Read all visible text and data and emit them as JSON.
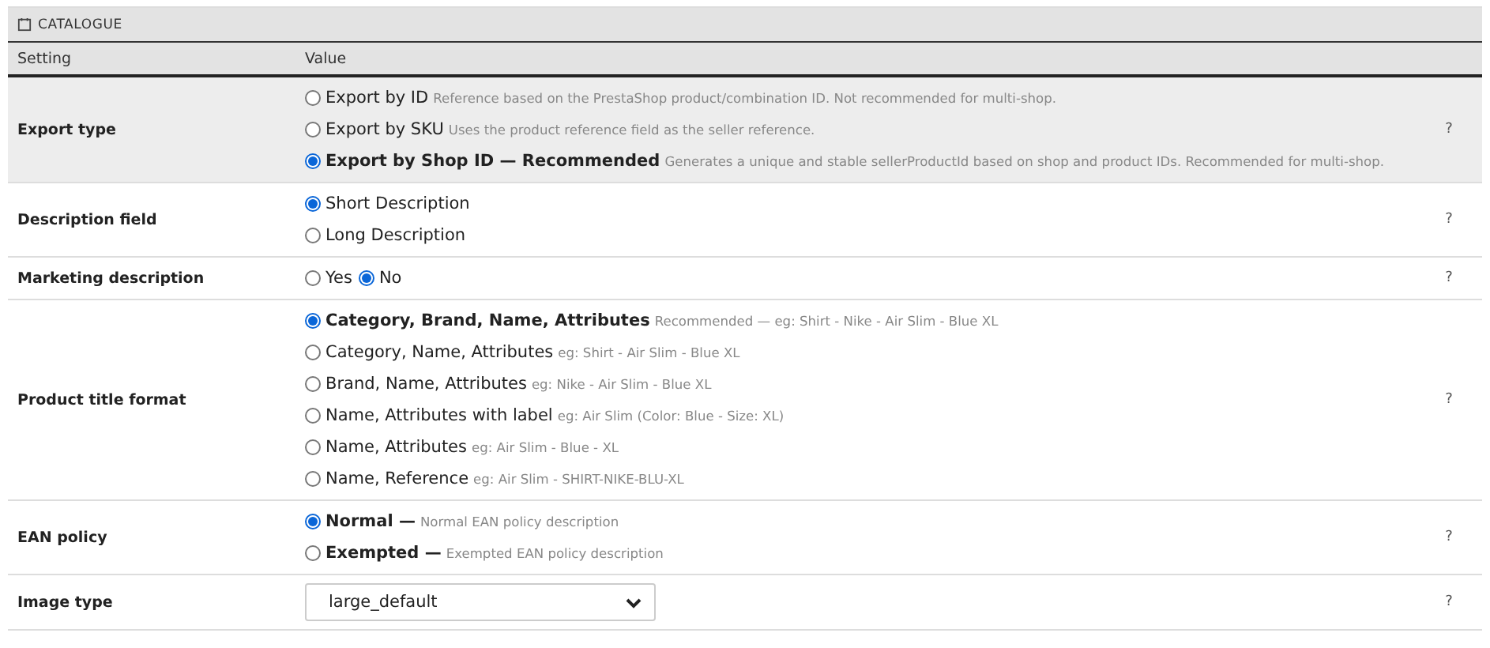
{
  "panel": {
    "title": "CATALOGUE"
  },
  "columns": [
    "Setting",
    "Value"
  ],
  "rows": [
    {
      "setting": "Export type",
      "kind": "radio",
      "highlighted": true,
      "help": "?",
      "options": [
        {
          "label": "Export by ID",
          "description": "Reference based on the PrestaShop product/combination ID. Not recommended for multi-shop.",
          "bold": false,
          "selected": false
        },
        {
          "label": "Export by SKU",
          "description": "Uses the product reference field as the seller reference.",
          "bold": false,
          "selected": false
        },
        {
          "label": "Export by Shop ID — Recommended",
          "description": "Generates a unique and stable sellerProductId based on shop and product IDs. Recommended for multi-shop.",
          "bold": true,
          "selected": true
        }
      ]
    },
    {
      "setting": "Description field",
      "kind": "radio",
      "highlighted": false,
      "help": "?",
      "options": [
        {
          "label": "Short Description",
          "bold": false,
          "selected": true
        },
        {
          "label": "Long Description",
          "bold": false,
          "selected": false
        }
      ]
    },
    {
      "setting": "Marketing description",
      "kind": "radio_inline",
      "highlighted": false,
      "help": "?",
      "options": [
        {
          "label": "Yes",
          "bold": false,
          "selected": false
        },
        {
          "label": "No",
          "bold": false,
          "selected": true
        }
      ]
    },
    {
      "setting": "Product title format",
      "kind": "radio",
      "highlighted": false,
      "help": "?",
      "options": [
        {
          "label": "Category, Brand, Name, Attributes",
          "description": "Recommended — eg: Shirt - Nike - Air Slim - Blue XL",
          "bold": true,
          "selected": true
        },
        {
          "label": "Category, Name, Attributes",
          "description": "eg: Shirt - Air Slim - Blue XL",
          "bold": false,
          "selected": false
        },
        {
          "label": "Brand, Name, Attributes",
          "description": "eg: Nike - Air Slim - Blue XL",
          "bold": false,
          "selected": false
        },
        {
          "label": "Name, Attributes with label",
          "description": "eg: Air Slim (Color: Blue - Size: XL)",
          "bold": false,
          "selected": false
        },
        {
          "label": "Name, Attributes",
          "description": "eg: Air Slim - Blue - XL",
          "bold": false,
          "selected": false
        },
        {
          "label": "Name, Reference",
          "description": "eg: Air Slim - SHIRT-NIKE-BLU-XL",
          "bold": false,
          "selected": false
        }
      ]
    },
    {
      "setting": "EAN policy",
      "kind": "radio",
      "highlighted": false,
      "help": "?",
      "options": [
        {
          "label": "Normal —",
          "description": "Normal EAN policy description",
          "bold": true,
          "selected": true
        },
        {
          "label": "Exempted —",
          "description": "Exempted EAN policy description",
          "bold": true,
          "selected": false
        }
      ]
    },
    {
      "setting": "Image type",
      "kind": "select",
      "highlighted": false,
      "help": "?",
      "value": "large_default"
    }
  ]
}
